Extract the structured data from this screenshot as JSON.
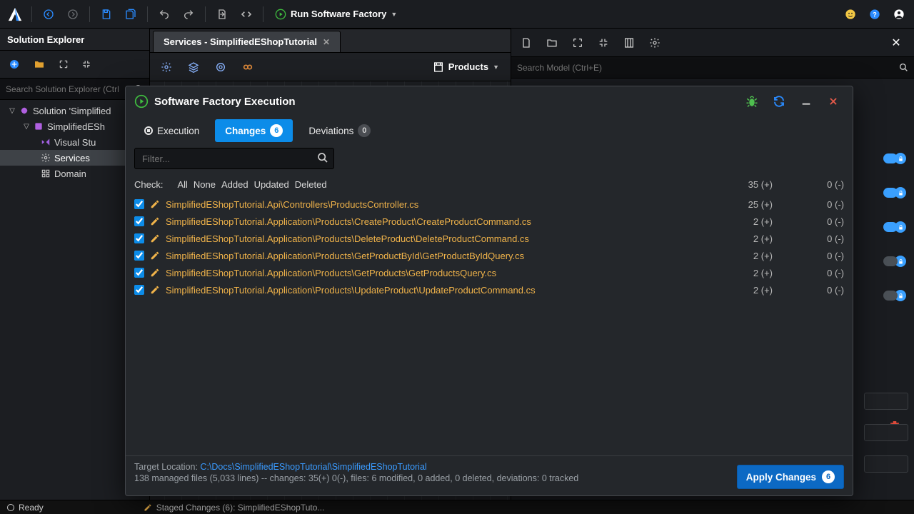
{
  "topbar": {
    "run_label": "Run Software Factory"
  },
  "left": {
    "title": "Solution Explorer",
    "search_placeholder": "Search Solution Explorer (Ctrl",
    "tree": {
      "solution": "Solution 'Simplified",
      "project": "SimplifiedESh",
      "children": [
        "Visual Stu",
        "Services",
        "Domain"
      ]
    }
  },
  "center": {
    "tab": "Services - SimplifiedEShopTutorial",
    "dropdown": "Products"
  },
  "right": {
    "search_placeholder": "Search Model (Ctrl+E)"
  },
  "modal": {
    "title": "Software Factory Execution",
    "tabs": {
      "execution": "Execution",
      "changes": "Changes",
      "changes_count": "6",
      "deviations": "Deviations",
      "dev_count": "0"
    },
    "filter_placeholder": "Filter...",
    "check_label": "Check:",
    "check_opts": [
      "All",
      "None",
      "Added",
      "Updated",
      "Deleted"
    ],
    "totals": {
      "added": "35 (+)",
      "removed": "0 (-)"
    },
    "files": [
      {
        "path": "SimplifiedEShopTutorial.Api\\Controllers\\ProductsController.cs",
        "a": "25 (+)",
        "r": "0 (-)"
      },
      {
        "path": "SimplifiedEShopTutorial.Application\\Products\\CreateProduct\\CreateProductCommand.cs",
        "a": "2 (+)",
        "r": "0 (-)"
      },
      {
        "path": "SimplifiedEShopTutorial.Application\\Products\\DeleteProduct\\DeleteProductCommand.cs",
        "a": "2 (+)",
        "r": "0 (-)"
      },
      {
        "path": "SimplifiedEShopTutorial.Application\\Products\\GetProductById\\GetProductByIdQuery.cs",
        "a": "2 (+)",
        "r": "0 (-)"
      },
      {
        "path": "SimplifiedEShopTutorial.Application\\Products\\GetProducts\\GetProductsQuery.cs",
        "a": "2 (+)",
        "r": "0 (-)"
      },
      {
        "path": "SimplifiedEShopTutorial.Application\\Products\\UpdateProduct\\UpdateProductCommand.cs",
        "a": "2 (+)",
        "r": "0 (-)"
      }
    ],
    "target_label": "Target Location: ",
    "target_path": "C:\\Docs\\SimplifiedEShopTutorial\\SimplifiedEShopTutorial",
    "summary": "138 managed files (5,033 lines) -- changes: 35(+) 0(-), files: 6 modified, 0 added, 0 deleted, deviations: 0 tracked",
    "apply": "Apply Changes",
    "apply_count": "6"
  },
  "status": {
    "ready": "Ready",
    "staged": "Staged Changes (6): SimplifiedEShopTuto..."
  }
}
